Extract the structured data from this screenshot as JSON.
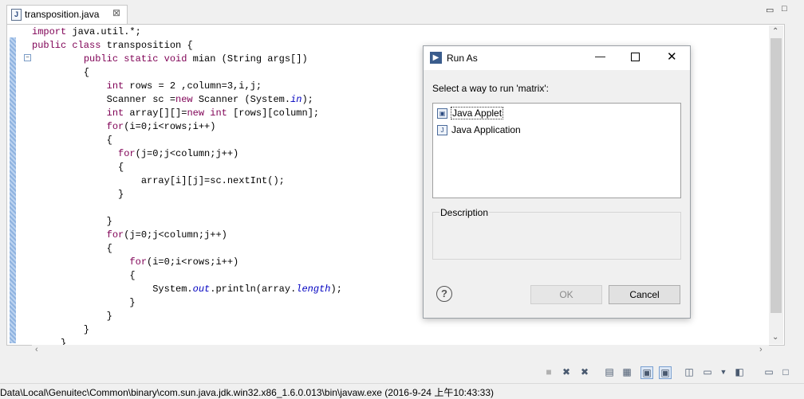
{
  "editor": {
    "tab_title": "transposition.java",
    "tab_close": "⊠",
    "view_controls": {
      "minimize": "▭",
      "maximize": "□"
    },
    "code_lines": [
      [
        [
          "kw",
          "import"
        ],
        [
          "t",
          " java.util.*;"
        ]
      ],
      [
        [
          "kw",
          "public class"
        ],
        [
          "t",
          " transposition {"
        ]
      ],
      [
        [
          "t",
          "         "
        ],
        [
          "kw",
          "public static void"
        ],
        [
          "t",
          " mian (String args[])"
        ]
      ],
      [
        [
          "t",
          "         {"
        ]
      ],
      [
        [
          "t",
          "             "
        ],
        [
          "kw",
          "int"
        ],
        [
          "t",
          " rows = 2 ,column=3,i,j;"
        ]
      ],
      [
        [
          "t",
          "             Scanner sc ="
        ],
        [
          "kw",
          "new"
        ],
        [
          "t",
          " Scanner (System."
        ],
        [
          "fld",
          "in"
        ],
        [
          "t",
          ");"
        ]
      ],
      [
        [
          "t",
          "             "
        ],
        [
          "kw",
          "int"
        ],
        [
          "t",
          " array[][]="
        ],
        [
          "kw",
          "new int"
        ],
        [
          "t",
          " [rows][column];"
        ]
      ],
      [
        [
          "t",
          "             "
        ],
        [
          "kw",
          "for"
        ],
        [
          "t",
          "(i=0;i<rows;i++)"
        ]
      ],
      [
        [
          "t",
          "             {"
        ]
      ],
      [
        [
          "t",
          "               "
        ],
        [
          "kw",
          "for"
        ],
        [
          "t",
          "(j=0;j<column;j++)"
        ]
      ],
      [
        [
          "t",
          "               {"
        ]
      ],
      [
        [
          "t",
          "                   array[i][j]=sc.nextInt();"
        ]
      ],
      [
        [
          "t",
          "               }"
        ]
      ],
      [
        [
          "t",
          ""
        ]
      ],
      [
        [
          "t",
          "             }"
        ]
      ],
      [
        [
          "t",
          "             "
        ],
        [
          "kw",
          "for"
        ],
        [
          "t",
          "(j=0;j<column;j++)"
        ]
      ],
      [
        [
          "t",
          "             {"
        ]
      ],
      [
        [
          "t",
          "                 "
        ],
        [
          "kw",
          "for"
        ],
        [
          "t",
          "(i=0;i<rows;i++)"
        ]
      ],
      [
        [
          "t",
          "                 {"
        ]
      ],
      [
        [
          "t",
          "                     System."
        ],
        [
          "fld",
          "out"
        ],
        [
          "t",
          ".println(array."
        ],
        [
          "fld",
          "length"
        ],
        [
          "t",
          ");"
        ]
      ],
      [
        [
          "t",
          "                 }"
        ]
      ],
      [
        [
          "t",
          "             }"
        ]
      ],
      [
        [
          "t",
          "         }"
        ]
      ],
      [
        [
          "t",
          "     }"
        ]
      ]
    ]
  },
  "status_bar": {
    "text": "Data\\Local\\Genuitec\\Common\\binary\\com.sun.java.jdk.win32.x86_1.6.0.013\\bin\\javaw.exe (2016-9-24 上午10:43:33)"
  },
  "toolbar_icons": [
    "terminate-icon",
    "remove-launch-icon",
    "remove-all-icon",
    "scroll-lock-icon",
    "show-console-icon",
    "pin-console-icon",
    "new-console-icon",
    "open-console-icon",
    "display-console-icon",
    "minimize-icon",
    "maximize-icon"
  ],
  "dialog": {
    "title": "Run As",
    "prompt": "Select a way to run 'matrix':",
    "options": [
      {
        "label": "Java Applet",
        "selected": true,
        "icon": "applet-icon"
      },
      {
        "label": "Java Application",
        "selected": false,
        "icon": "java-app-icon"
      }
    ],
    "description_label": "Description",
    "description_text": "",
    "ok_label": "OK",
    "cancel_label": "Cancel",
    "help_symbol": "?"
  },
  "colors": {
    "keyword": "#7f0055",
    "field": "#0000c0",
    "selection_ruler": "#8fb3e0"
  }
}
